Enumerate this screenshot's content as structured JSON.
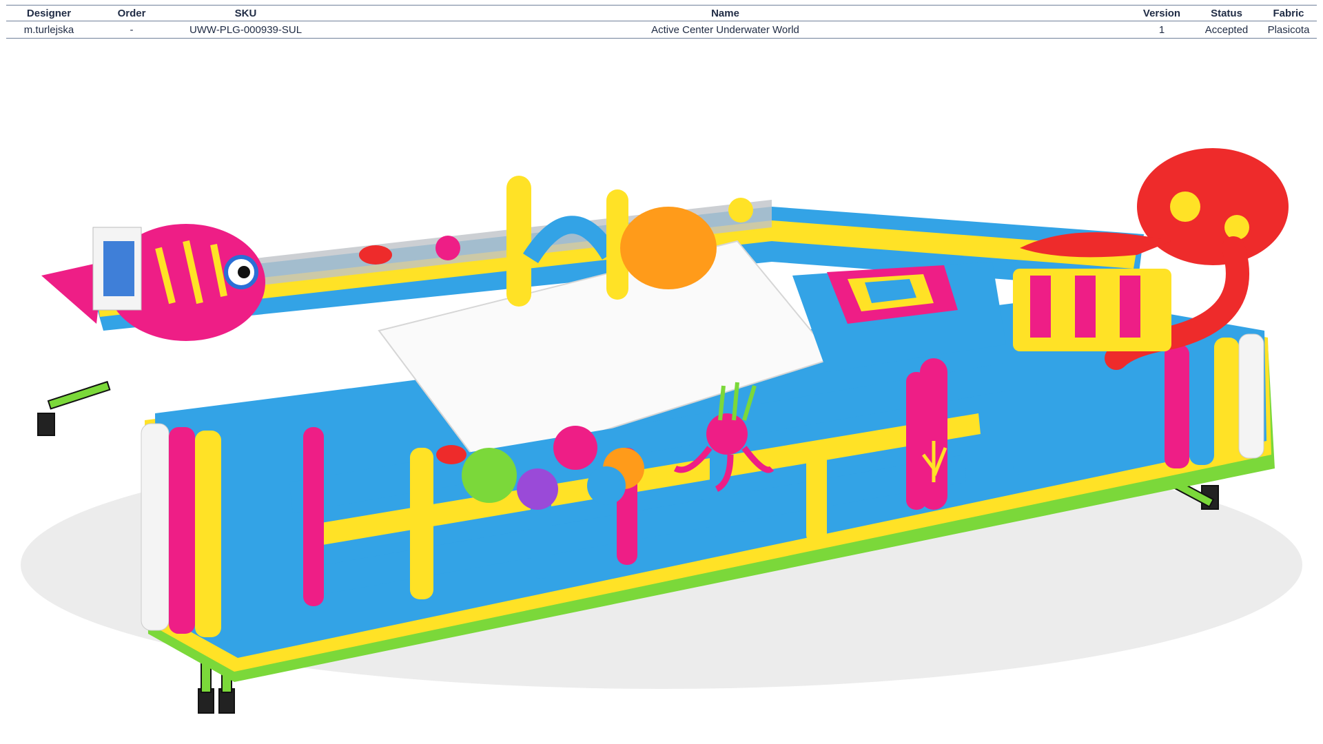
{
  "table": {
    "headers": {
      "designer": "Designer",
      "order": "Order",
      "sku": "SKU",
      "name": "Name",
      "version": "Version",
      "status": "Status",
      "fabric": "Fabric"
    },
    "row": {
      "designer": "m.turlejska",
      "order": "-",
      "sku": "UWW-PLG-000939-SUL",
      "name": "Active Center Underwater World",
      "version": "1",
      "status": "Accepted",
      "fabric": "Plasicota"
    }
  },
  "render": {
    "subject": "underwater-themed inflatable play center",
    "colors": {
      "blue": "#33a3e6",
      "yellow": "#ffe226",
      "pink": "#ee1e86",
      "red": "#ee2b2b",
      "green": "#7bd83a",
      "white": "#f4f4f4",
      "orange": "#ff9b1a"
    }
  }
}
